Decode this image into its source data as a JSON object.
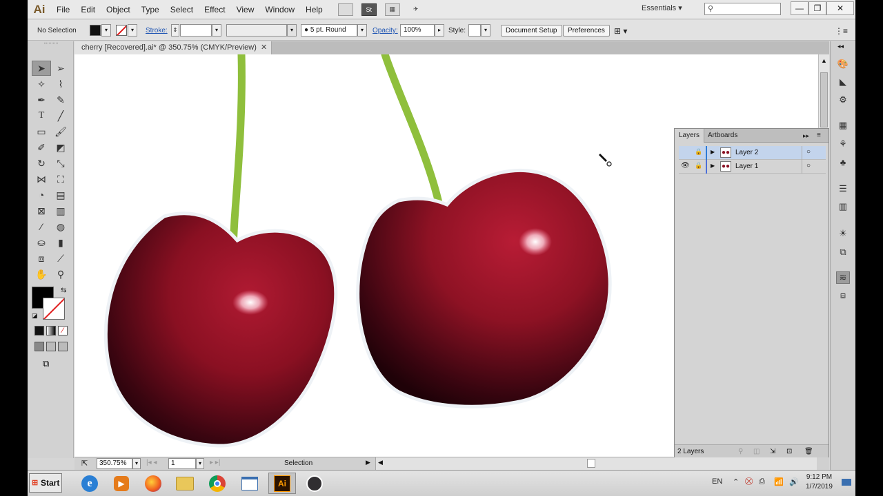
{
  "menubar": {
    "logo": "Ai",
    "items": [
      "File",
      "Edit",
      "Object",
      "Type",
      "Select",
      "Effect",
      "View",
      "Window",
      "Help"
    ],
    "icon_st": "St",
    "workspace": "Essentials",
    "window_controls": [
      "—",
      "❐",
      "✕"
    ]
  },
  "controlbar": {
    "selection_state": "No Selection",
    "stroke_label": "Stroke:",
    "brush_value": "5 pt. Round",
    "opacity_label": "Opacity:",
    "opacity_value": "100%",
    "style_label": "Style:",
    "document_setup": "Document Setup",
    "preferences": "Preferences"
  },
  "document": {
    "tab_title": "cherry [Recovered].ai* @ 350.75% (CMYK/Preview)",
    "zoom": "350.75%",
    "artboard": "1",
    "status_tool": "Selection"
  },
  "layers_panel": {
    "tabs": [
      "Layers",
      "Artboards"
    ],
    "layers": [
      {
        "name": "Layer 2",
        "color": "#2e7bd6",
        "selected": true
      },
      {
        "name": "Layer 1",
        "color": "#4b6fd9",
        "selected": false
      }
    ],
    "count_label": "2 Layers"
  },
  "taskbar": {
    "start": "Start",
    "lang": "EN",
    "time": "9:12 PM",
    "date": "1/7/2019"
  },
  "colors": {
    "cherry_dark": "#3a0510",
    "cherry_main": "#8a1022",
    "stem": "#9cc24a",
    "accent_blue": "#1f55b3"
  }
}
